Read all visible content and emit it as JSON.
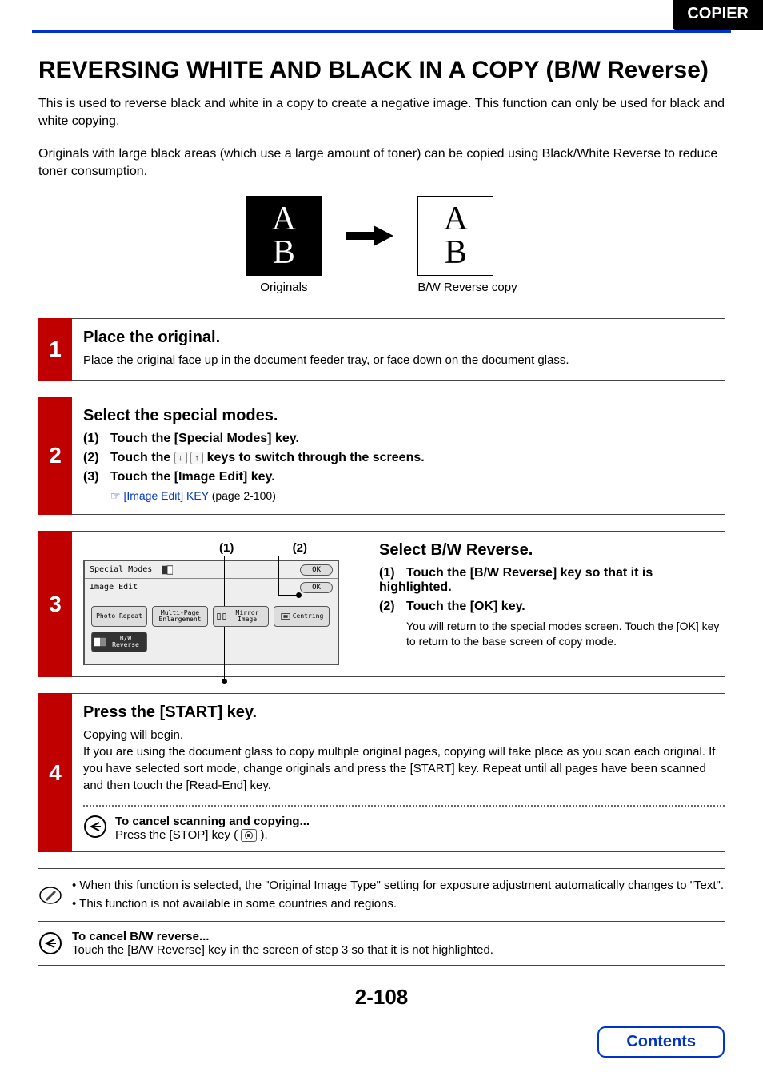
{
  "header": {
    "tab": "COPIER"
  },
  "title": "REVERSING WHITE AND BLACK IN A COPY (B/W Reverse)",
  "intro1": "This is used to reverse black and white in a copy to create a negative image. This function can only be used for black and white copying.",
  "intro2": "Originals with large black areas (which use a large amount of toner) can be copied using Black/White Reverse to reduce toner consumption.",
  "illustration": {
    "glyph1": "A",
    "glyph2": "B",
    "cap_left": "Originals",
    "cap_right": "B/W Reverse copy"
  },
  "steps": {
    "s1": {
      "num": "1",
      "title": "Place the original.",
      "desc": "Place the original face up in the document feeder tray, or face down on the document glass."
    },
    "s2": {
      "num": "2",
      "title": "Select the special modes.",
      "i1": {
        "p": "(1)",
        "t": "Touch the [Special Modes] key."
      },
      "i2": {
        "p": "(2)",
        "t_a": "Touch the ",
        "t_b": " keys to switch through the screens."
      },
      "i3": {
        "p": "(3)",
        "t": "Touch the [Image Edit] key."
      },
      "ref_link": "[Image Edit] KEY",
      "ref_page": " (page 2-100)"
    },
    "s3": {
      "num": "3",
      "callouts": {
        "c1": "(1)",
        "c2": "(2)"
      },
      "panel": {
        "row1_label": "Special Modes",
        "row2_label": "Image Edit",
        "ok": "OK",
        "b_photo": "Photo Repeat",
        "b_multi": "Multi-Page Enlargement",
        "b_mirror": "Mirror Image",
        "b_centring": "Centring",
        "b_bw": "B/W Reverse"
      },
      "title": "Select B/W Reverse.",
      "i1": {
        "p": "(1)",
        "t": "Touch the [B/W Reverse] key so that it is highlighted."
      },
      "i2": {
        "p": "(2)",
        "t": "Touch the [OK] key.",
        "body": "You will return to the special modes screen. Touch the [OK] key to return to the base screen of copy mode."
      }
    },
    "s4": {
      "num": "4",
      "title": "Press the [START] key.",
      "d1": "Copying will begin.",
      "d2": "If you are using the document glass to copy multiple original pages, copying will take place as you scan each original. If you have selected sort mode, change originals and press the [START] key. Repeat until all pages have been scanned and then touch the [Read-End] key.",
      "cancel_t": "To cancel scanning and copying...",
      "cancel_b_a": "Press the [STOP] key ( ",
      "cancel_b_b": " )."
    }
  },
  "notes": {
    "n1": "When this function is selected, the \"Original Image Type\" setting for exposure adjustment automatically changes to \"Text\".",
    "n2": "This function is not available in some countries and regions."
  },
  "cancel2": {
    "t": "To cancel B/W reverse...",
    "b": "Touch the [B/W Reverse] key in the screen of step 3 so that it is not highlighted."
  },
  "page_num": "2-108",
  "contents": "Contents"
}
